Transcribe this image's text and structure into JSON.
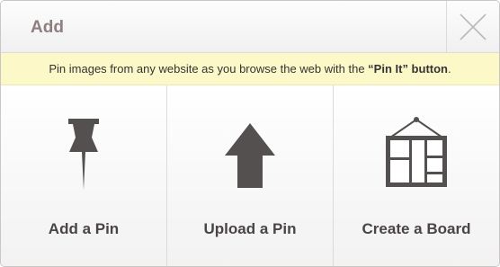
{
  "dialog": {
    "title": "Add",
    "close_icon": "close-icon"
  },
  "notice": {
    "text_before": "Pin images from any website as you browse the web with the ",
    "highlight": "“Pin It” button",
    "text_after": "."
  },
  "options": [
    {
      "label": "Add a Pin",
      "icon": "pushpin-icon"
    },
    {
      "label": "Upload a Pin",
      "icon": "up-arrow-icon"
    },
    {
      "label": "Create a Board",
      "icon": "board-icon"
    }
  ],
  "colors": {
    "header_title": "#8d7f7f",
    "notice_bg": "#fdf8c8",
    "icon": "#555050",
    "label": "#4a4444"
  }
}
